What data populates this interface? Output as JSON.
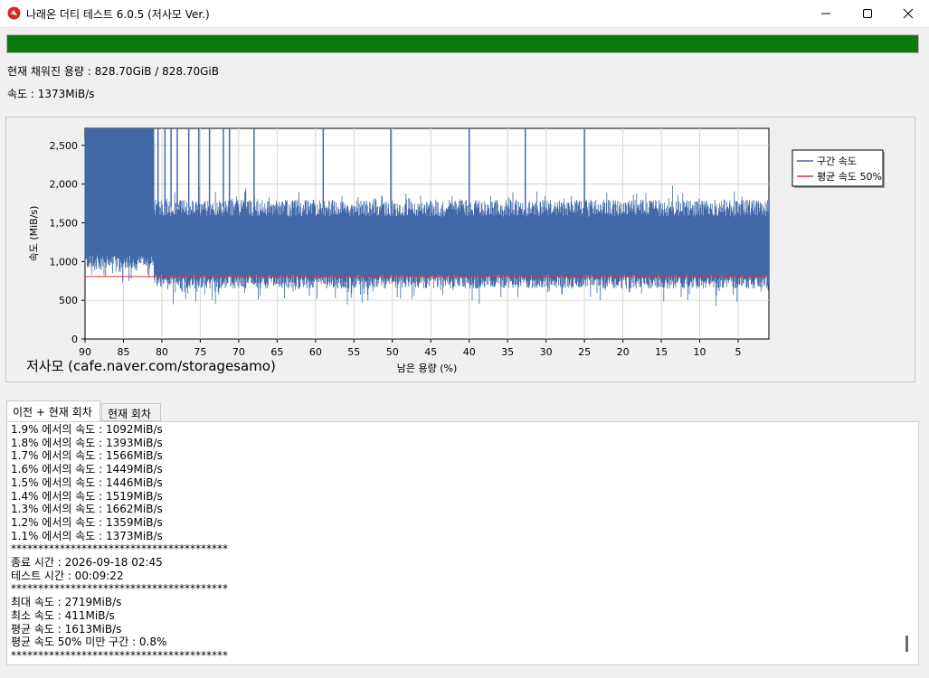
{
  "window": {
    "title": "나래온 더티 테스트 6.0.5 (저사모 Ver.)",
    "minimize_icon": "minimize-icon",
    "maximize_icon": "maximize-icon",
    "close_icon": "close-icon"
  },
  "progress": {
    "fraction": 1.0,
    "color": "#0c7a0c"
  },
  "status": {
    "capacity": "현재 채워진 용량 : 828.70GiB / 828.70GiB",
    "speed": "속도 : 1373MiB/s"
  },
  "chart_data": {
    "type": "line",
    "xlabel": "남은 용량 (%)",
    "ylabel": "속도 (MiB/s)",
    "xlim": [
      90,
      1
    ],
    "ylim": [
      0,
      2719
    ],
    "x_ticks": [
      "90",
      "85",
      "80",
      "75",
      "70",
      "65",
      "60",
      "55",
      "50",
      "45",
      "40",
      "35",
      "30",
      "25",
      "20",
      "15",
      "10",
      "5"
    ],
    "y_ticks": [
      "2,500",
      "2,000",
      "1,500",
      "1,000",
      "500",
      "0"
    ],
    "grid": true,
    "legend_placement": "right",
    "series": [
      {
        "name": "구간 속도",
        "color": "#4169a8",
        "segments": [
          {
            "x_from": 90,
            "x_to": 81,
            "low": 900,
            "high": 2719
          },
          {
            "x_from": 81,
            "x_to": 1,
            "low": 650,
            "high": 1800
          }
        ],
        "spikes_x": [
          80.5,
          79.6,
          78.8,
          78,
          76.5,
          75.2,
          73.8,
          72,
          71.2,
          68,
          59,
          50.2,
          40,
          32.7,
          25
        ]
      },
      {
        "name": "평균 속도 50%",
        "color": "#e03030",
        "values": [
          806
        ]
      }
    ]
  },
  "watermark": "저사모 (cafe.naver.com/storagesamo)",
  "tabs": [
    {
      "label": "이전 + 현재 회차",
      "active": true
    },
    {
      "label": "현재 회차",
      "active": false
    }
  ],
  "log_lines": [
    "1.9% 에서의 속도 : 1092MiB/s",
    "1.8% 에서의 속도 : 1393MiB/s",
    "1.7% 에서의 속도 : 1566MiB/s",
    "1.6% 에서의 속도 : 1449MiB/s",
    "1.5% 에서의 속도 : 1446MiB/s",
    "1.4% 에서의 속도 : 1519MiB/s",
    "1.3% 에서의 속도 : 1662MiB/s",
    "1.2% 에서의 속도 : 1359MiB/s",
    "1.1% 에서의 속도 : 1373MiB/s",
    "****************************************",
    "종료 시간 : 2026-09-18 02:45",
    "테스트 시간 : 00:09:22",
    "****************************************",
    "최대 속도 : 2719MiB/s",
    "최소 속도 : 411MiB/s",
    "평균 속도 : 1613MiB/s",
    "평균 속도 50% 미만 구간 : 0.8%",
    "****************************************"
  ]
}
